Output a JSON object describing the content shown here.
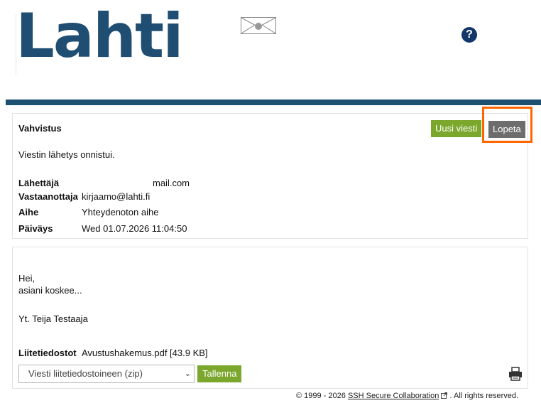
{
  "header": {
    "logo_text": "Lahti",
    "help_icon": "?"
  },
  "confirmation": {
    "title": "Vahvistus",
    "new_message_label": "Uusi viesti",
    "quit_label": "Lopeta",
    "status_text": "Viestin lähetys onnistui.",
    "fields": {
      "sender_label": "Lähettäjä",
      "sender_value": "mail.com",
      "recipient_label": "Vastaanottaja",
      "recipient_value": "kirjaamo@lahti.fi",
      "subject_label": "Aihe",
      "subject_value": "Yhteydenoton aihe",
      "date_label": "Päiväys",
      "date_value": "Wed 01.07.2026 11:04:50"
    }
  },
  "message": {
    "greeting": "Hei,",
    "body": "asiani koskee...",
    "signature": "Yt. Teija Testaaja",
    "attachments_label": "Liitetiedostot",
    "attachment_file": "Avustushakemus.pdf [43.9 KB]",
    "download_select_value": "Viesti liitetiedostoineen (zip)",
    "save_label": "Tallenna"
  },
  "footer": {
    "copyright_prefix": "© 1999 - 2026",
    "link_text": "SSH Secure Collaboration",
    "suffix": ". All rights reserved."
  },
  "colors": {
    "brand_blue": "#1f4e72",
    "green_button": "#7aa72c",
    "grey_button": "#6d6d6d",
    "highlight_orange": "#ff6600"
  }
}
